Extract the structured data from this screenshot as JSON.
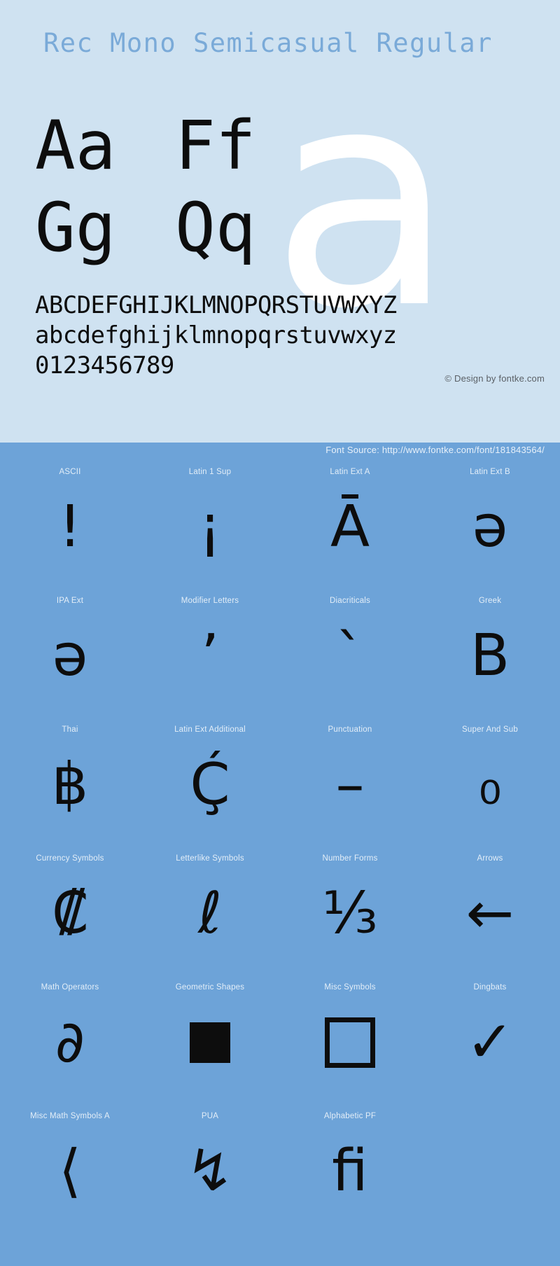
{
  "specimen": {
    "title": "Rec Mono Semicasual Regular",
    "watermark_glyph": "a",
    "letter_pairs": [
      [
        "Aa",
        "Ff"
      ],
      [
        "Gg",
        "Qq"
      ]
    ],
    "alphabet_lines": [
      "ABCDEFGHIJKLMNOPQRSTUVWXYZ",
      "abcdefghijklmnopqrstuvwxyz",
      "0123456789"
    ],
    "copyright": "© Design by fontke.com",
    "colors": {
      "panel_bg": "#cfe2f1",
      "band_bg": "#6da3d8",
      "title": "#7aaad8",
      "glyph": "#0d0d0d",
      "watermark": "#ffffff",
      "label": "#e3eef8"
    }
  },
  "source_bar": {
    "text": "Font Source: http://www.fontke.com/font/181843564/"
  },
  "unicode_blocks": [
    [
      {
        "label": "ASCII",
        "sample": "!"
      },
      {
        "label": "Latin 1 Sup",
        "sample": "¡"
      },
      {
        "label": "Latin Ext A",
        "sample": "Ā"
      },
      {
        "label": "Latin Ext B",
        "sample": "ǝ"
      }
    ],
    [
      {
        "label": "IPA Ext",
        "sample": "ə"
      },
      {
        "label": "Modifier Letters",
        "sample": "ʼ"
      },
      {
        "label": "Diacriticals",
        "sample": "ˋ"
      },
      {
        "label": "Greek",
        "sample": "Β"
      }
    ],
    [
      {
        "label": "Thai",
        "sample": "฿"
      },
      {
        "label": "Latin Ext Additional",
        "sample": "Ḉ"
      },
      {
        "label": "Punctuation",
        "sample": "–"
      },
      {
        "label": "Super And Sub",
        "sample": "₀"
      }
    ],
    [
      {
        "label": "Currency Symbols",
        "sample": "₡"
      },
      {
        "label": "Letterlike Symbols",
        "sample": "ℓ"
      },
      {
        "label": "Number Forms",
        "sample": "⅓"
      },
      {
        "label": "Arrows",
        "sample": "←"
      }
    ],
    [
      {
        "label": "Math Operators",
        "sample": "∂"
      },
      {
        "label": "Geometric Shapes",
        "sample": "■"
      },
      {
        "label": "Misc Symbols",
        "sample": "□"
      },
      {
        "label": "Dingbats",
        "sample": "✓"
      }
    ],
    [
      {
        "label": "Misc Math Symbols A",
        "sample": "⟨"
      },
      {
        "label": "PUA",
        "sample": "↯"
      },
      {
        "label": "Alphabetic PF",
        "sample": "ﬁ"
      },
      {
        "label": "",
        "sample": ""
      }
    ]
  ]
}
